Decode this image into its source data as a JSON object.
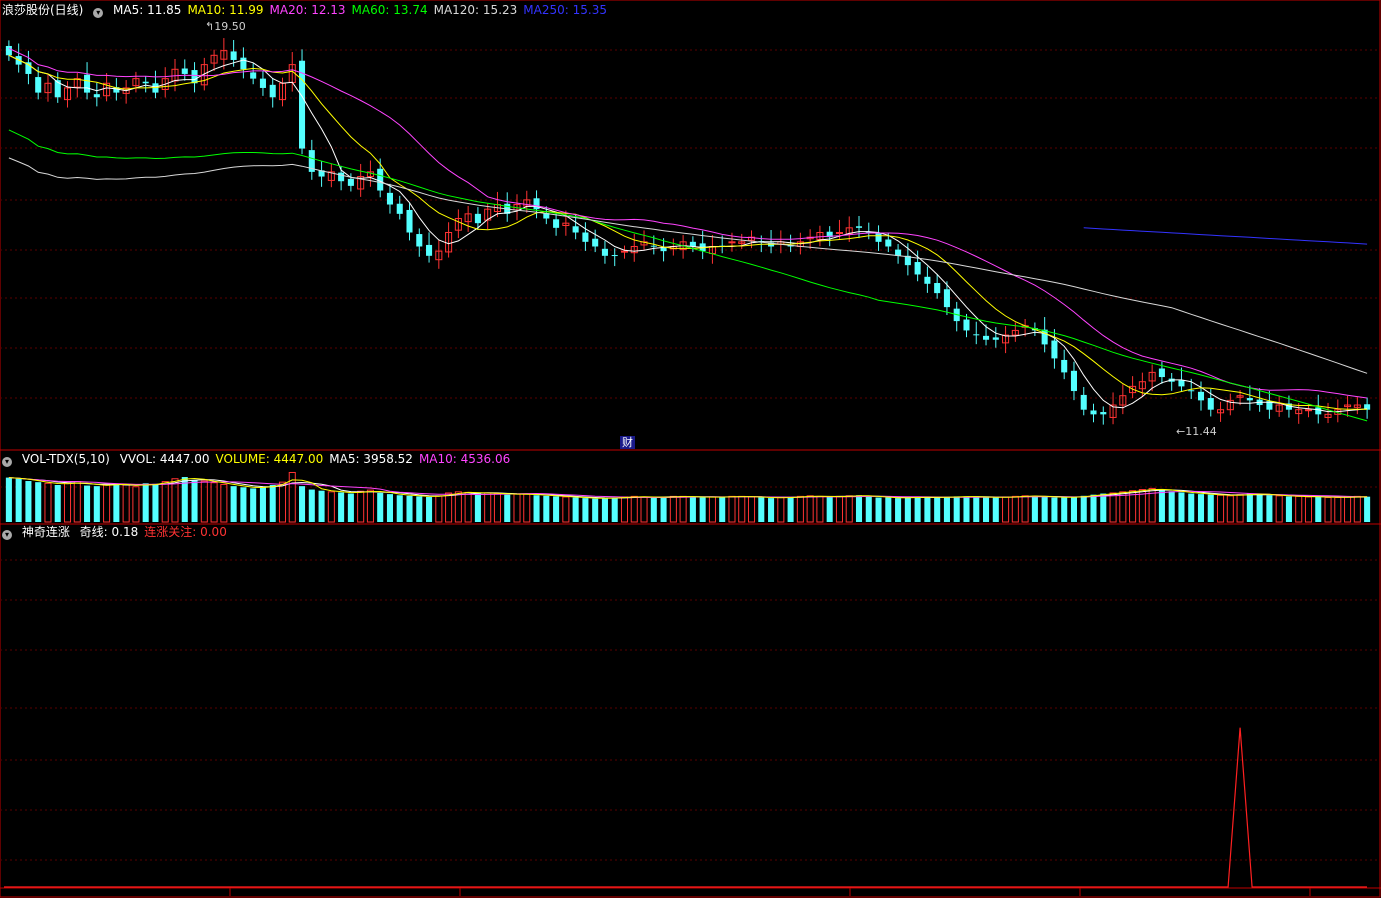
{
  "main_panel": {
    "name": "浪莎股份(日线)",
    "ma": [
      {
        "label": "MA5",
        "value": "11.85",
        "color": "#ffffff"
      },
      {
        "label": "MA10",
        "value": "11.99",
        "color": "#ffff00"
      },
      {
        "label": "MA20",
        "value": "12.13",
        "color": "#ff44ff"
      },
      {
        "label": "MA60",
        "value": "13.74",
        "color": "#00ff00"
      },
      {
        "label": "MA120",
        "value": "15.23",
        "color": "#d8d8d8"
      },
      {
        "label": "MA250",
        "value": "15.35",
        "color": "#3333ff"
      }
    ],
    "high_mark": "19.50",
    "low_mark": "11.44",
    "cai_tag": "财"
  },
  "vol_panel": {
    "name": "VOL-TDX(5,10)",
    "items": [
      {
        "label": "VVOL",
        "value": "4447.00",
        "color": "#ffffff"
      },
      {
        "label": "VOLUME",
        "value": "4447.00",
        "color": "#ffff00"
      },
      {
        "label": "MA5",
        "value": "3958.52",
        "color": "#ffffff"
      },
      {
        "label": "MA10",
        "value": "4536.06",
        "color": "#ff44ff"
      }
    ]
  },
  "ind_panel": {
    "name": "神奇连涨",
    "items": [
      {
        "label": "奇线",
        "value": "0.18",
        "color": "#ffffff"
      },
      {
        "label": "连涨关注",
        "value": "0.00",
        "color": "#ff3333"
      }
    ]
  },
  "chart_data": {
    "type": "candlestick",
    "price_range": [
      11.0,
      20.2
    ],
    "up_color": "#ff3333",
    "down_color": "#54ffff",
    "n": 140,
    "close": [
      19.4,
      19.2,
      19.0,
      18.6,
      18.8,
      18.5,
      18.7,
      18.9,
      18.6,
      18.5,
      18.8,
      18.6,
      18.7,
      18.9,
      18.8,
      18.6,
      18.9,
      19.1,
      19.0,
      18.8,
      19.2,
      19.4,
      19.5,
      19.3,
      19.1,
      18.9,
      18.7,
      18.5,
      18.8,
      19.2,
      17.4,
      16.9,
      16.8,
      16.9,
      16.7,
      16.6,
      16.8,
      16.9,
      16.5,
      16.2,
      16.0,
      15.6,
      15.3,
      15.1,
      15.2,
      15.6,
      15.9,
      16.0,
      15.8,
      16.1,
      16.2,
      16.0,
      16.2,
      16.3,
      16.1,
      15.9,
      15.7,
      15.8,
      15.6,
      15.4,
      15.3,
      15.1,
      15.1,
      15.2,
      15.3,
      15.4,
      15.3,
      15.2,
      15.3,
      15.4,
      15.3,
      15.2,
      15.3,
      15.3,
      15.4,
      15.4,
      15.5,
      15.4,
      15.3,
      15.4,
      15.3,
      15.4,
      15.5,
      15.6,
      15.5,
      15.6,
      15.7,
      15.7,
      15.6,
      15.4,
      15.3,
      15.1,
      14.9,
      14.7,
      14.5,
      14.3,
      14.0,
      13.7,
      13.5,
      13.4,
      13.3,
      13.3,
      13.4,
      13.5,
      13.6,
      13.5,
      13.2,
      12.9,
      12.6,
      12.2,
      11.8,
      11.7,
      11.7,
      11.9,
      12.1,
      12.3,
      12.4,
      12.6,
      12.5,
      12.4,
      12.3,
      12.2,
      12.0,
      11.8,
      11.8,
      12.0,
      12.1,
      12.0,
      11.9,
      11.8,
      11.9,
      11.8,
      11.8,
      11.8,
      11.7,
      11.7,
      11.8,
      11.9,
      11.9,
      11.8
    ],
    "volume": [
      7800,
      7600,
      7200,
      7000,
      6800,
      6500,
      6900,
      7100,
      6400,
      6300,
      6600,
      6700,
      6500,
      6200,
      6800,
      6700,
      7100,
      7600,
      7900,
      7400,
      7200,
      6900,
      6600,
      6300,
      6100,
      5900,
      6200,
      6500,
      7000,
      8700,
      6300,
      5700,
      5500,
      5300,
      5200,
      5000,
      5400,
      5600,
      5100,
      4900,
      4700,
      4600,
      4500,
      4400,
      4600,
      5100,
      5300,
      5200,
      5000,
      5100,
      5000,
      4800,
      4900,
      4900,
      4700,
      4600,
      4500,
      4400,
      4300,
      4200,
      4100,
      4200,
      4300,
      4400,
      4500,
      4400,
      4300,
      4400,
      4500,
      4500,
      4400,
      4300,
      4400,
      4400,
      4500,
      4500,
      4400,
      4300,
      4200,
      4300,
      4400,
      4500,
      4600,
      4500,
      4400,
      4500,
      4600,
      4700,
      4500,
      4300,
      4300,
      4200,
      4300,
      4400,
      4300,
      4300,
      4400,
      4500,
      4500,
      4400,
      4300,
      4300,
      4400,
      4500,
      4600,
      4600,
      4400,
      4300,
      4300,
      4400,
      4600,
      4800,
      5000,
      5100,
      5300,
      5500,
      5700,
      5900,
      5600,
      5400,
      5200,
      5000,
      4900,
      4800,
      4700,
      4600,
      4800,
      5000,
      4900,
      4700,
      4600,
      4500,
      4500,
      4400,
      4400,
      4300,
      4300,
      4400,
      4500,
      4447
    ],
    "ma_lines": [
      {
        "name": "MA5",
        "color": "#ffffff"
      },
      {
        "name": "MA10",
        "color": "#ffff00"
      },
      {
        "name": "MA20",
        "color": "#ff44ff"
      },
      {
        "name": "MA60",
        "color": "#00ff00"
      },
      {
        "name": "MA120",
        "color": "#d8d8d8"
      },
      {
        "name": "MA250",
        "color": "#3333ff"
      }
    ],
    "indicator_spike_index": 126,
    "indicator_spike_value": 0.18
  }
}
